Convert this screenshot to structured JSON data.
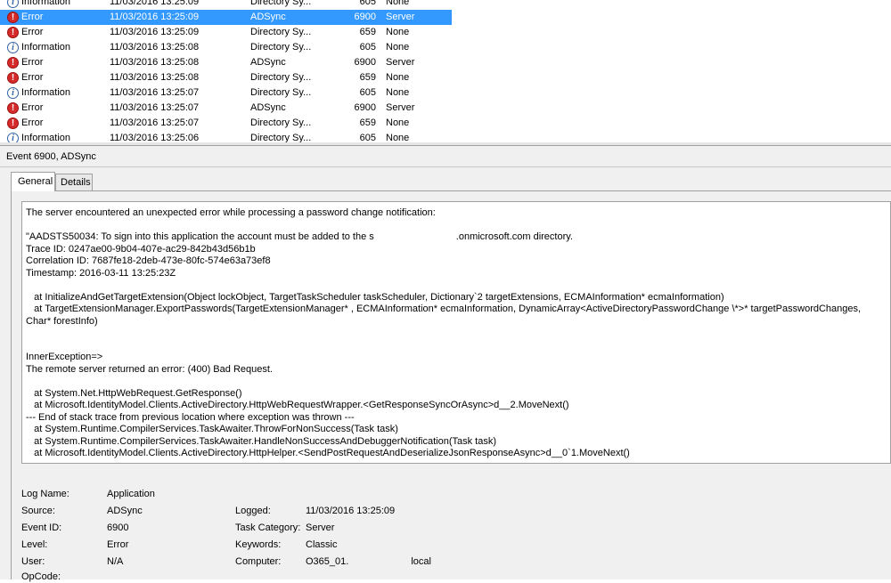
{
  "events": [
    {
      "level": "Information",
      "date": "11/03/2016 13:25:09",
      "source": "Directory Sy...",
      "id": "605",
      "category": "None",
      "type": "info"
    },
    {
      "level": "Error",
      "date": "11/03/2016 13:25:09",
      "source": "ADSync",
      "id": "6900",
      "category": "Server",
      "type": "error",
      "selected": true
    },
    {
      "level": "Error",
      "date": "11/03/2016 13:25:09",
      "source": "Directory Sy...",
      "id": "659",
      "category": "None",
      "type": "error"
    },
    {
      "level": "Information",
      "date": "11/03/2016 13:25:08",
      "source": "Directory Sy...",
      "id": "605",
      "category": "None",
      "type": "info"
    },
    {
      "level": "Error",
      "date": "11/03/2016 13:25:08",
      "source": "ADSync",
      "id": "6900",
      "category": "Server",
      "type": "error"
    },
    {
      "level": "Error",
      "date": "11/03/2016 13:25:08",
      "source": "Directory Sy...",
      "id": "659",
      "category": "None",
      "type": "error"
    },
    {
      "level": "Information",
      "date": "11/03/2016 13:25:07",
      "source": "Directory Sy...",
      "id": "605",
      "category": "None",
      "type": "info"
    },
    {
      "level": "Error",
      "date": "11/03/2016 13:25:07",
      "source": "ADSync",
      "id": "6900",
      "category": "Server",
      "type": "error"
    },
    {
      "level": "Error",
      "date": "11/03/2016 13:25:07",
      "source": "Directory Sy...",
      "id": "659",
      "category": "None",
      "type": "error"
    },
    {
      "level": "Information",
      "date": "11/03/2016 13:25:06",
      "source": "Directory Sy...",
      "id": "605",
      "category": "None",
      "type": "info"
    }
  ],
  "detail": {
    "header": "Event 6900, ADSync",
    "tabs": {
      "general": "General",
      "details": "Details"
    }
  },
  "description": {
    "line1": "The server encountered an unexpected error while processing a password change notification:",
    "aad_prefix": " \"AADSTS50034: To sign into this application the account must be added to the s",
    "aad_suffix": ".onmicrosoft.com directory.",
    "trace_id": "Trace ID: 0247ae00-9b04-407e-ac29-842b43d56b1b",
    "correlation_id": "Correlation ID: 7687fe18-2deb-473e-80fc-574e63a73ef8",
    "timestamp": "Timestamp: 2016-03-11 13:25:23Z",
    "stack1": "   at InitializeAndGetTargetExtension(Object lockObject, TargetTaskScheduler taskScheduler, Dictionary`2 targetExtensions, ECMAInformation* ecmaInformation)",
    "stack2": "   at TargetExtensionManager.ExportPasswords(TargetExtensionManager* , ECMAInformation* ecmaInformation, DynamicArray<ActiveDirectoryPasswordChange \\*>* targetPasswordChanges, Char* forestInfo)",
    "inner": "InnerException=>",
    "inner_msg": "The remote server returned an error: (400) Bad Request.",
    "stack3": "   at System.Net.HttpWebRequest.GetResponse()",
    "stack4": "   at Microsoft.IdentityModel.Clients.ActiveDirectory.HttpWebRequestWrapper.<GetResponseSyncOrAsync>d__2.MoveNext()",
    "stack5": "--- End of stack trace from previous location where exception was thrown ---",
    "stack6": "   at System.Runtime.CompilerServices.TaskAwaiter.ThrowForNonSuccess(Task task)",
    "stack7": "   at System.Runtime.CompilerServices.TaskAwaiter.HandleNonSuccessAndDebuggerNotification(Task task)",
    "stack8": "   at Microsoft.IdentityModel.Clients.ActiveDirectory.HttpHelper.<SendPostRequestAndDeserializeJsonResponseAsync>d__0`1.MoveNext()"
  },
  "properties": {
    "log_name_label": "Log Name:",
    "log_name": "Application",
    "source_label": "Source:",
    "source": "ADSync",
    "event_id_label": "Event ID:",
    "event_id": "6900",
    "level_label": "Level:",
    "level": "Error",
    "user_label": "User:",
    "user": "N/A",
    "opcode_label": "OpCode:",
    "logged_label": "Logged:",
    "logged": "11/03/2016 13:25:09",
    "task_category_label": "Task Category:",
    "task_category": "Server",
    "keywords_label": "Keywords:",
    "keywords": "Classic",
    "computer_label": "Computer:",
    "computer_prefix": "O365_01.",
    "computer_suffix": "local"
  },
  "colors": {
    "selection": "#3399ff",
    "error_icon": "#d42a2a",
    "info_icon": "#3264a8"
  }
}
